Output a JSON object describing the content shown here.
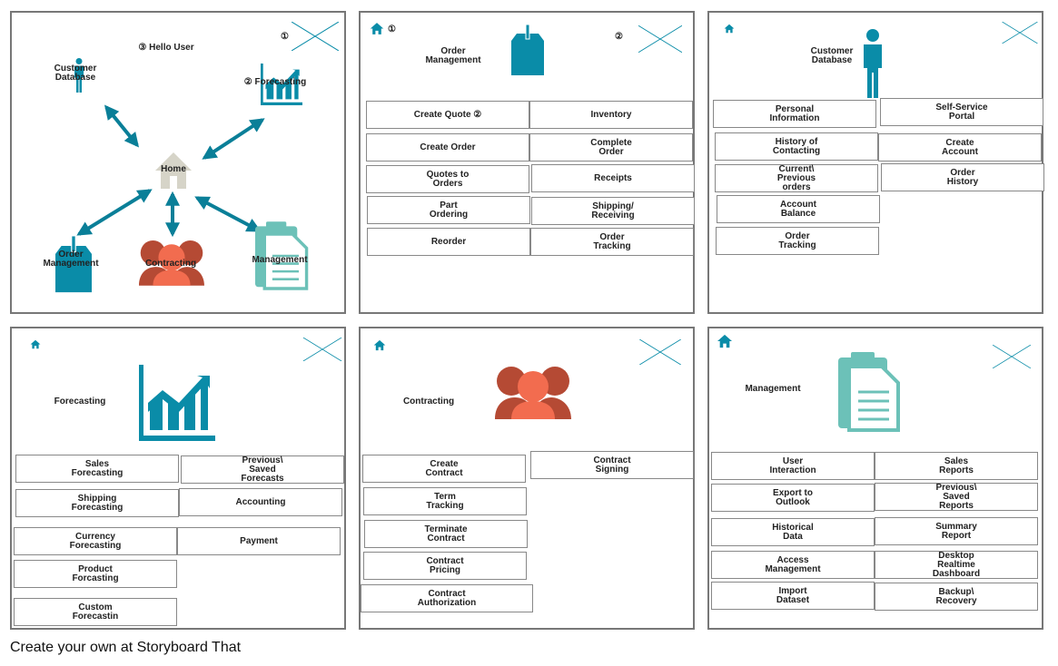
{
  "colors": {
    "accent": "#0a8ca8",
    "contract": "#f26c4f",
    "contract_dark": "#b54a34",
    "management": "#6cc1b8",
    "home": "#d6d4c8"
  },
  "panel1": {
    "hello": "③ Hello User",
    "customer_db": "Customer\nDatabase",
    "forecasting": "② Forecasting",
    "home": "Home",
    "order_mgmt": "Order\nManagement",
    "contracting": "Contracting",
    "management": "Management",
    "marker": "①"
  },
  "panel2": {
    "title": "Order\nManagement",
    "marker1": "①",
    "marker2": "②",
    "buttons": [
      "Create Quote  ②",
      "Inventory",
      "Create Order",
      "Complete\nOrder",
      "Quotes to\nOrders",
      "Receipts",
      "Part\nOrdering",
      "Shipping/\nReceiving",
      "Reorder",
      "Order\nTracking"
    ]
  },
  "panel3": {
    "title": "Customer\nDatabase",
    "buttons": [
      "Personal\nInformation",
      "Self-Service\nPortal",
      "History of\nContacting",
      "Create\nAccount",
      "Current\\\nPrevious\norders",
      "Order\nHistory",
      "Account\nBalance",
      "Order\nTracking"
    ]
  },
  "panel4": {
    "title": "Forecasting",
    "buttons": [
      "Sales\nForecasting",
      "Previous\\\nSaved\nForecasts",
      "Shipping\nForecasting",
      "Accounting",
      "Currency\nForecasting",
      "Payment",
      "Product\nForcasting",
      "Custom\nForecastin"
    ]
  },
  "panel5": {
    "title": "Contracting",
    "buttons": [
      "Create\nContract",
      "Contract\nSigning",
      "Term\nTracking",
      "Terminate\nContract",
      "Contract\nPricing",
      "Contract\nAuthorization"
    ]
  },
  "panel6": {
    "title": "Management",
    "buttons": [
      "User\nInteraction",
      "Sales\nReports",
      "Export to\nOutlook",
      "Previous\\\nSaved\nReports",
      "Historical\nData",
      "Summary\nReport",
      "Access\nManagement",
      "Desktop\nRealtime\nDashboard",
      "Import\nDataset",
      "Backup\\\nRecovery"
    ]
  },
  "footer": "Create your own at Storyboard That"
}
